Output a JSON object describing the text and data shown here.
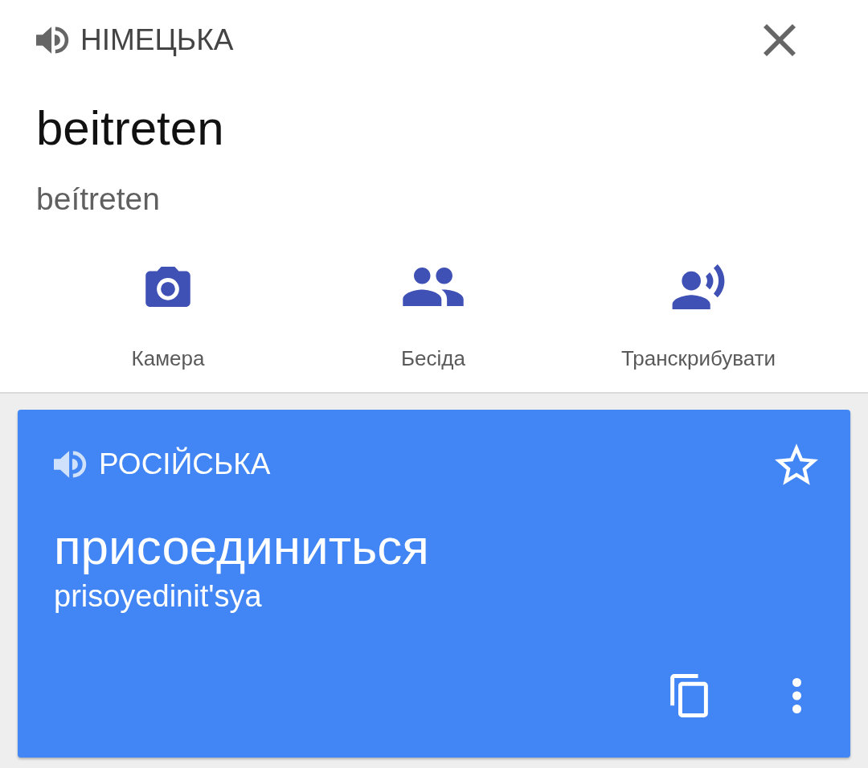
{
  "source": {
    "language": "НІМЕЦЬКА",
    "text": "beitreten",
    "transliteration": "beítreten"
  },
  "actions": [
    {
      "kind": "camera",
      "label": "Камера"
    },
    {
      "kind": "conversation",
      "label": "Бесіда"
    },
    {
      "kind": "transcribe",
      "label": "Транскрибувати"
    }
  ],
  "translation": {
    "language": "РОСІЙСЬКА",
    "text": "присоединиться",
    "transliteration": "prisoyedinit'sya",
    "starred": false
  }
}
